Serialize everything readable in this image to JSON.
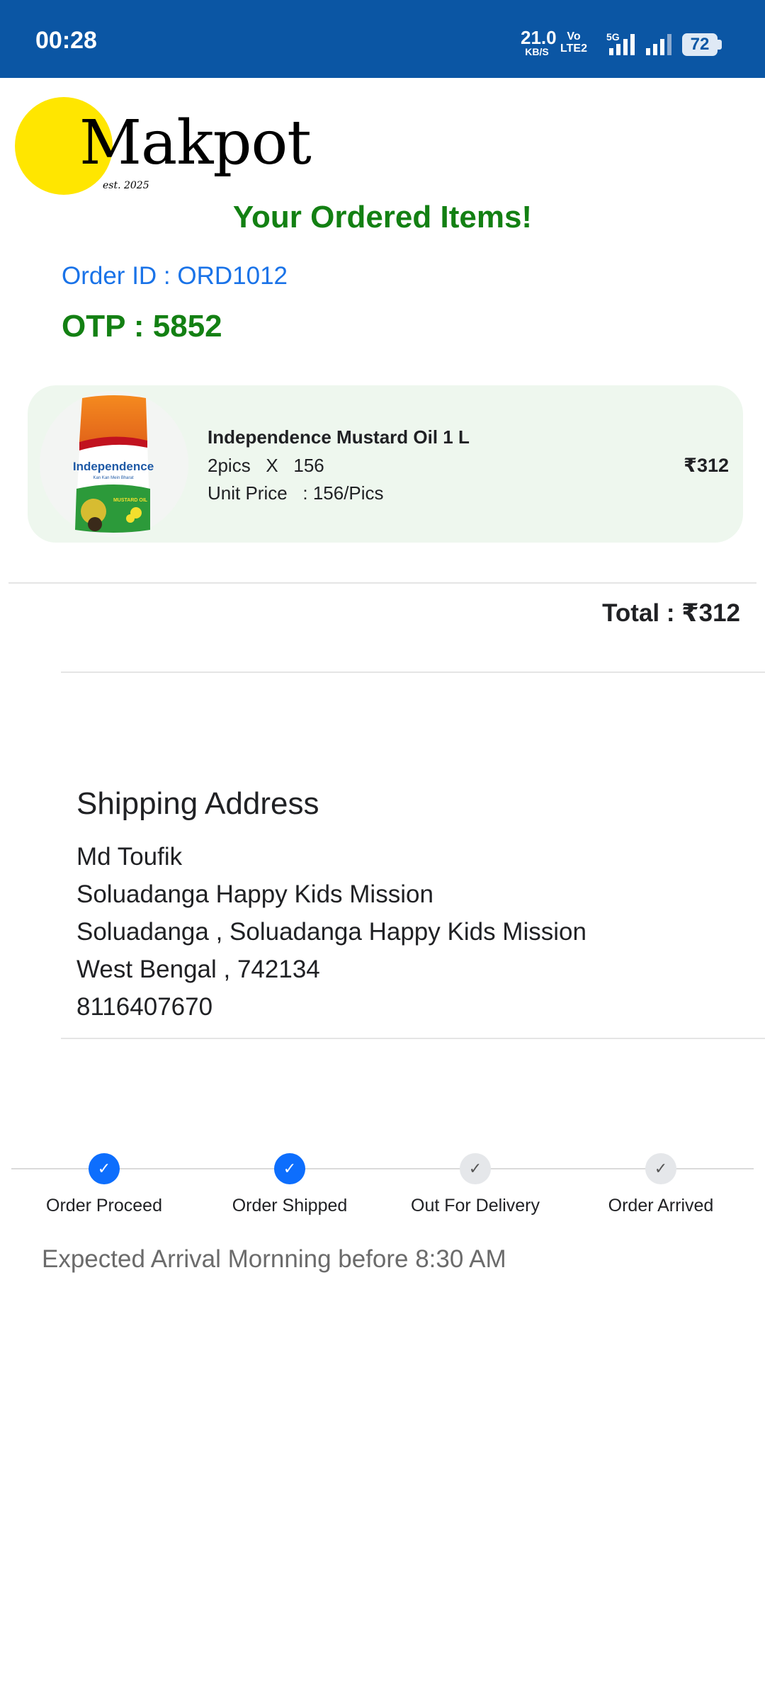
{
  "status_bar": {
    "time": "00:28",
    "net_speed": "21.0",
    "net_speed_unit": "KB/S",
    "volte_top": "Vo",
    "volte_bottom": "LTE2",
    "network": "5G",
    "battery": "72"
  },
  "brand": {
    "logo_text": "Makpot",
    "est": "est. 2025",
    "colors": {
      "logo_circle": "#ffe600",
      "status_bar": "#0b56a4",
      "accent_green": "#138013",
      "accent_blue": "#1a73e8"
    }
  },
  "page_title": "Your Ordered Items!",
  "order": {
    "id_label": "Order ID : ORD1012",
    "otp_label": "OTP : 5852"
  },
  "items": [
    {
      "name": "Independence Mustard Oil 1 L",
      "qty_line": "2pics   X   156",
      "unit_price_line": "Unit Price   : 156/Pics",
      "price": "₹312",
      "image_icon": "mustard-oil-pouch",
      "image_brand": "Independence",
      "image_sub": "Kan Kan Mein Bharat",
      "image_product": "MUSTARD OIL"
    }
  ],
  "total": "Total : ₹312",
  "shipping": {
    "title": "Shipping Address",
    "lines": [
      "Md Toufik",
      "Soluadanga Happy Kids Mission",
      "Soluadanga , Soluadanga Happy Kids Mission",
      "West Bengal , 742134",
      "8116407670"
    ]
  },
  "tracking": {
    "steps": [
      {
        "label": "Order Proceed",
        "done": true,
        "icon": "check-icon"
      },
      {
        "label": "Order Shipped",
        "done": true,
        "icon": "check-icon"
      },
      {
        "label": "Out For Delivery",
        "done": false,
        "icon": "check-icon"
      },
      {
        "label": "Order Arrived",
        "done": false,
        "icon": "check-icon"
      }
    ],
    "check_glyph": "✓",
    "expected": "Expected Arrival Mornning before 8:30 AM"
  }
}
